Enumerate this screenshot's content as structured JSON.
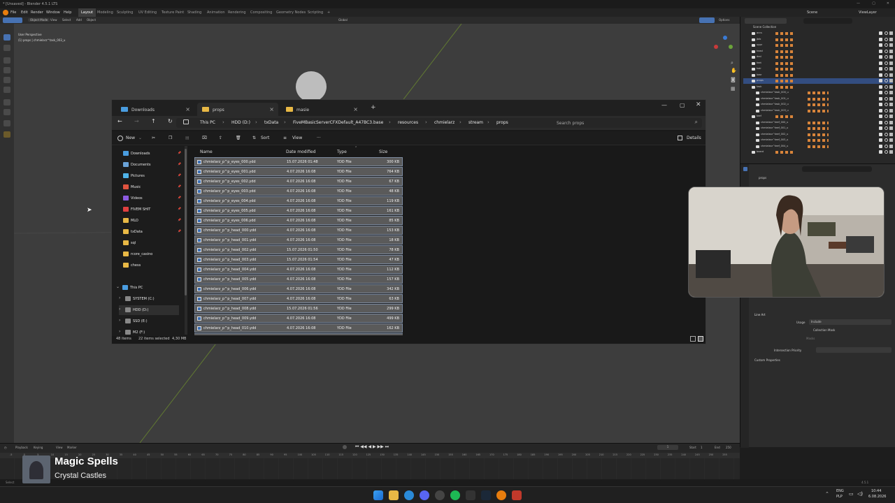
{
  "blender": {
    "title": "* [Unsaved] - Blender 4.5.1 LTS",
    "menus": [
      "File",
      "Edit",
      "Render",
      "Window",
      "Help"
    ],
    "workspaces": [
      "Layout",
      "Modeling",
      "Sculpting",
      "UV Editing",
      "Texture Paint",
      "Shading",
      "Animation",
      "Rendering",
      "Compositing",
      "Geometry Nodes",
      "Scripting"
    ],
    "scene": "Scene",
    "view_layer": "ViewLayer",
    "viewport_header": {
      "mode": "Object Mode",
      "items": [
        "View",
        "Select",
        "Add",
        "Object"
      ],
      "orientation": "Global",
      "options": "Options"
    },
    "overlay_text": {
      "perspective": "User Perspective",
      "collection": "(1) props | chmielarz^task_003_u"
    },
    "outliner": {
      "header": "Scene Collection",
      "items": [
        "accs",
        "jbib",
        "uppr",
        "head",
        "decl",
        "feet",
        "hair",
        "lowr",
        "props",
        "task",
        "chmielarz^task_000_u",
        "chmielarz^task_001_u",
        "chmielarz^task_002_u",
        "chmielarz^task_003_u",
        "teef",
        "chmielarz^teef_000_u",
        "chmielarz^teef_001_u",
        "chmielarz^teef_002_u",
        "chmielarz^teef_003_u",
        "chmielarz^teef_004_u",
        "beard"
      ]
    },
    "properties": {
      "object": "props",
      "line_art": "Line Art",
      "usage_label": "Usage",
      "usage_value": "Include",
      "collection_mask": "Collection Mask",
      "masks_label": "Masks",
      "intersection_priority": "Intersection Priority",
      "custom_properties": "Custom Properties"
    },
    "timeline": {
      "items": [
        "Playback",
        "Keying",
        "View",
        "Marker"
      ],
      "frame": "1",
      "start_label": "Start",
      "start": "1",
      "end_label": "End",
      "end": "250",
      "ticks": [
        "-5",
        "0",
        "5",
        "10",
        "15",
        "20",
        "25",
        "30",
        "35",
        "40",
        "45",
        "50",
        "55",
        "60",
        "65",
        "70",
        "75",
        "80",
        "85",
        "90",
        "95",
        "100",
        "105",
        "110",
        "115",
        "120",
        "125",
        "130",
        "135",
        "140",
        "145",
        "150",
        "155",
        "160",
        "165",
        "170",
        "175",
        "180",
        "185",
        "190",
        "195",
        "200",
        "205",
        "210",
        "215",
        "220",
        "225",
        "230",
        "235",
        "240",
        "245",
        "250",
        "255"
      ]
    },
    "status": {
      "select": "Select",
      "version": "4.5.1"
    }
  },
  "explorer": {
    "tabs": [
      {
        "label": "Downloads"
      },
      {
        "label": "props"
      },
      {
        "label": "masie"
      }
    ],
    "breadcrumb": [
      "This PC",
      "HDD (D:)",
      "txData",
      "FiveMBasicServerCFXDefault_A47BC3.base",
      "resources",
      "chmielarz",
      "stream",
      "props"
    ],
    "search_placeholder": "Search props",
    "toolbar": {
      "new": "New",
      "sort": "Sort",
      "view": "View",
      "more": "···",
      "details": "Details"
    },
    "nav": [
      {
        "label": "Downloads",
        "color": "#4a9de0",
        "pin": true
      },
      {
        "label": "Documents",
        "color": "#6aa3d8",
        "pin": true
      },
      {
        "label": "Pictures",
        "color": "#4fb3e8",
        "pin": true
      },
      {
        "label": "Music",
        "color": "#e0533f",
        "pin": true
      },
      {
        "label": "Videos",
        "color": "#8c5be0",
        "pin": true
      },
      {
        "label": "FIVEM SHIT",
        "color": "#e04040",
        "pin": true
      },
      {
        "label": "MLO",
        "color": "#e8b845",
        "pin": true
      },
      {
        "label": "txData",
        "color": "#e8b845",
        "pin": true
      },
      {
        "label": "sql",
        "color": "#e8b845",
        "pin": false
      },
      {
        "label": "rcore_casino",
        "color": "#e8b845",
        "pin": false
      },
      {
        "label": "chess",
        "color": "#e8b845",
        "pin": false
      }
    ],
    "drives": [
      {
        "label": "This PC"
      },
      {
        "label": "SYSTEM (C:)"
      },
      {
        "label": "HDD (D:)"
      },
      {
        "label": "SSD (E:)"
      },
      {
        "label": "M2 (F:)"
      }
    ],
    "columns": {
      "name": "Name",
      "date": "Date modified",
      "type": "Type",
      "size": "Size"
    },
    "files": [
      {
        "name": "chmielarz_p^p_eyes_000.ydd",
        "date": "15.07.2026 01:48",
        "type": "YDD File",
        "size": "300 KB"
      },
      {
        "name": "chmielarz_p^p_eyes_001.ydd",
        "date": "4.07.2026 16:08",
        "type": "YDD File",
        "size": "764 KB"
      },
      {
        "name": "chmielarz_p^p_eyes_002.ydd",
        "date": "4.07.2026 16:08",
        "type": "YDD File",
        "size": "67 KB"
      },
      {
        "name": "chmielarz_p^p_eyes_003.ydd",
        "date": "4.07.2026 16:08",
        "type": "YDD File",
        "size": "48 KB"
      },
      {
        "name": "chmielarz_p^p_eyes_004.ydd",
        "date": "4.07.2026 16:08",
        "type": "YDD File",
        "size": "119 KB"
      },
      {
        "name": "chmielarz_p^p_eyes_005.ydd",
        "date": "4.07.2026 16:08",
        "type": "YDD File",
        "size": "161 KB"
      },
      {
        "name": "chmielarz_p^p_eyes_006.ydd",
        "date": "4.07.2026 16:08",
        "type": "YDD File",
        "size": "85 KB"
      },
      {
        "name": "chmielarz_p^p_head_000.ydd",
        "date": "4.07.2026 16:08",
        "type": "YDD File",
        "size": "153 KB"
      },
      {
        "name": "chmielarz_p^p_head_001.ydd",
        "date": "4.07.2026 16:08",
        "type": "YDD File",
        "size": "18 KB"
      },
      {
        "name": "chmielarz_p^p_head_002.ydd",
        "date": "15.07.2026 01:50",
        "type": "YDD File",
        "size": "78 KB"
      },
      {
        "name": "chmielarz_p^p_head_003.ydd",
        "date": "15.07.2026 01:54",
        "type": "YDD File",
        "size": "47 KB"
      },
      {
        "name": "chmielarz_p^p_head_004.ydd",
        "date": "4.07.2026 16:08",
        "type": "YDD File",
        "size": "112 KB"
      },
      {
        "name": "chmielarz_p^p_head_005.ydd",
        "date": "4.07.2026 16:08",
        "type": "YDD File",
        "size": "157 KB"
      },
      {
        "name": "chmielarz_p^p_head_006.ydd",
        "date": "4.07.2026 16:08",
        "type": "YDD File",
        "size": "342 KB"
      },
      {
        "name": "chmielarz_p^p_head_007.ydd",
        "date": "4.07.2026 16:08",
        "type": "YDD File",
        "size": "63 KB"
      },
      {
        "name": "chmielarz_p^p_head_008.ydd",
        "date": "15.07.2026 01:56",
        "type": "YDD File",
        "size": "299 KB"
      },
      {
        "name": "chmielarz_p^p_head_009.ydd",
        "date": "4.07.2026 16:08",
        "type": "YDD File",
        "size": "499 KB"
      },
      {
        "name": "chmielarz_p^p_head_010.ydd",
        "date": "4.07.2026 16:08",
        "type": "YDD File",
        "size": "162 KB"
      }
    ],
    "status": {
      "items": "48 items",
      "selected": "22 items selected",
      "size": "4,30 MB"
    }
  },
  "music": {
    "title": "Magic Spells",
    "artist": "Crystal Castles"
  },
  "tray": {
    "lang": "ENG",
    "region": "PLP",
    "time": "10:44",
    "date": "6.08.2026"
  },
  "colors": {
    "accent": "#4772b3",
    "selection_border": "#7d8ba0",
    "folder": "#e8b845"
  }
}
